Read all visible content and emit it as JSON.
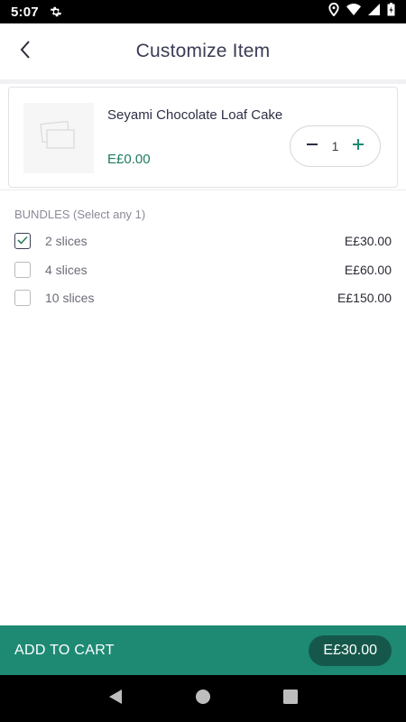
{
  "status_bar": {
    "time": "5:07"
  },
  "header": {
    "title": "Customize Item"
  },
  "item": {
    "name": "Seyami Chocolate Loaf Cake",
    "price": "E£0.00",
    "quantity": "1"
  },
  "bundles": {
    "header": "BUNDLES (Select any  1)",
    "options": [
      {
        "label": "2 slices",
        "price": "E£30.00",
        "checked": true
      },
      {
        "label": "4 slices",
        "price": "E£60.00",
        "checked": false
      },
      {
        "label": "10 slices",
        "price": "E£150.00",
        "checked": false
      }
    ]
  },
  "cart": {
    "label": "ADD TO CART",
    "total": "E£30.00"
  },
  "colors": {
    "accent": "#1e8a74",
    "accent_dark": "#15584b",
    "price_green": "#1f7a62"
  }
}
